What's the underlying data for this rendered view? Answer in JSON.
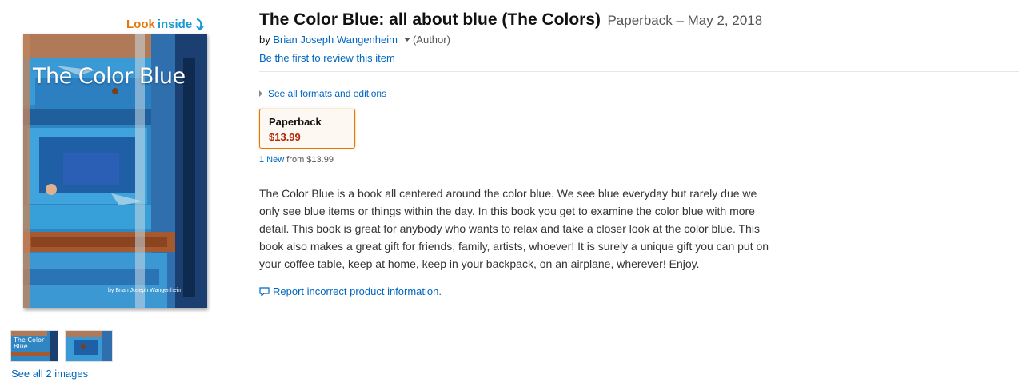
{
  "look_inside": {
    "word1": "Look",
    "word2": "inside"
  },
  "cover": {
    "title": "The Color Blue",
    "author": "by Brian Joseph Wangenheim"
  },
  "thumbnails": [
    {
      "title": "The Color Blue"
    },
    {
      "title": ""
    }
  ],
  "see_all_images": "See all 2 images",
  "product": {
    "title": "The Color Blue: all about blue (The Colors)",
    "binding_date": "Paperback – May 2, 2018",
    "by_prefix": "by",
    "author": "Brian Joseph Wangenheim",
    "author_role": "(Author)",
    "review_link": "Be the first to review this item"
  },
  "formats": {
    "see_all": "See all formats and editions",
    "selected": {
      "name": "Paperback",
      "price": "$13.99"
    },
    "offers_link": "1 New",
    "offers_from": "from $13.99"
  },
  "description": "The Color Blue is a book all centered around the color blue. We see blue everyday but rarely due we only see blue items or things within the day. In this book you get to examine the color blue with more detail. This book is great for anybody who wants to relax and take a closer look at the color blue. This book also makes a great gift for friends, family, artists, whoever! It is surely a unique gift you can put on your coffee table, keep at home, keep in your backpack, on an airplane, wherever! Enjoy.",
  "report_link": "Report incorrect product information.",
  "colors": {
    "link": "#0066c0",
    "price": "#b12704",
    "look": "#e47911",
    "inside": "#1a98d4",
    "format_border": "#e77600"
  }
}
